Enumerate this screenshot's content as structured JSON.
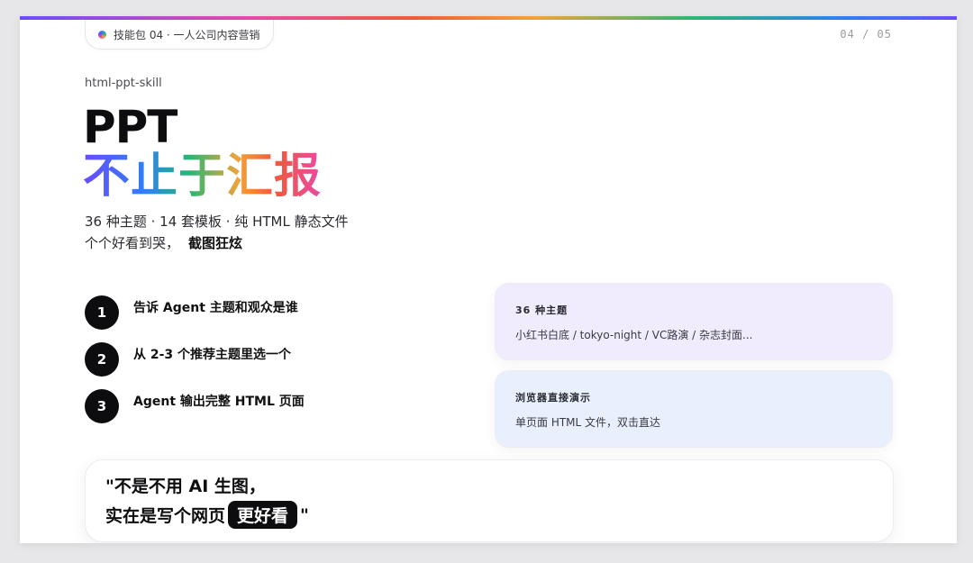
{
  "header": {
    "pill_label": "技能包 04 · 一人公司内容营销",
    "page_indicator": "04 / 05"
  },
  "hero": {
    "kicker": "html-ppt-skill",
    "title_line1": "PPT",
    "title_line2": "不止于汇报",
    "subtitle_line1": "36 种主题 · 14 套模板 · 纯 HTML 静态文件",
    "subtitle_line2": "个个好看到哭，",
    "subtitle_emphasis": "截图狂炫"
  },
  "steps": [
    {
      "number": "1",
      "label": "告诉 Agent 主题和观众是谁"
    },
    {
      "number": "2",
      "label": "从 2-3 个推荐主题里选一个"
    },
    {
      "number": "3",
      "label": "Agent 输出完整 HTML 页面"
    }
  ],
  "cards": [
    {
      "title": "36 种主题",
      "description": "小红书白底 / tokyo-night / VC路演 / 杂志封面..."
    },
    {
      "title": "浏览器直接演示",
      "description": "单页面 HTML 文件，双击直达"
    }
  ],
  "quote": {
    "line1": "\"不是不用 AI 生图，",
    "line2_prefix": "实在是写个网页",
    "line2_highlight": "更好看",
    "line2_suffix": "\""
  },
  "colors": {
    "accent_purple": "#6a4cff",
    "accent_blue": "#2f7ef5",
    "accent_green": "#2bb673",
    "accent_orange": "#f2a23a",
    "accent_pink": "#e94aa6",
    "card_1_bg": "#f0ecfd",
    "card_2_bg": "#e9f0fd"
  }
}
